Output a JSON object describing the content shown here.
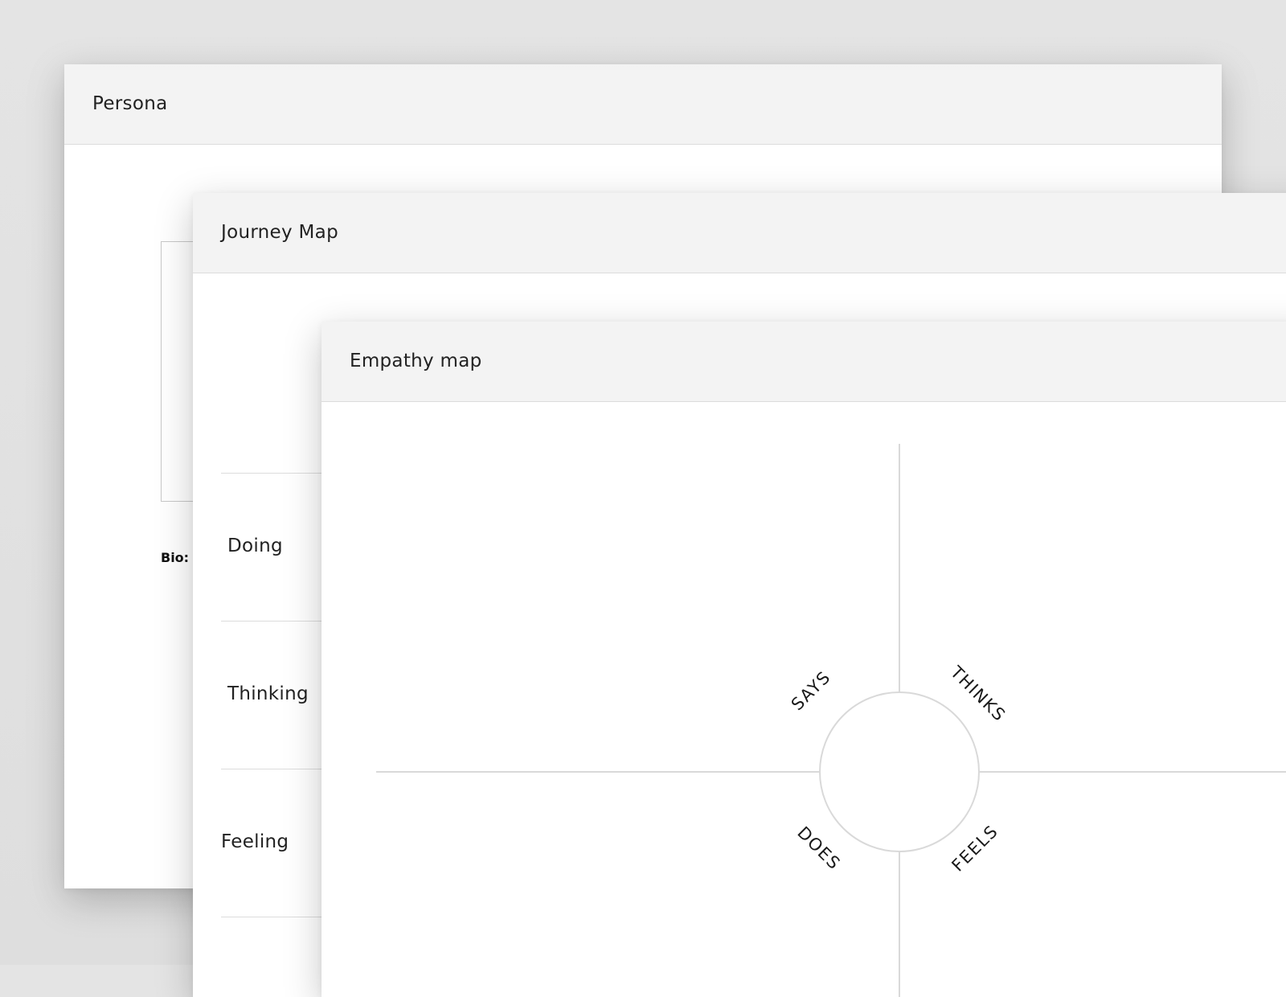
{
  "persona": {
    "title": "Persona",
    "bio_label": "Bio:"
  },
  "journey_map": {
    "title": "Journey Map",
    "rows": [
      "Doing",
      "Thinking",
      "Feeling"
    ]
  },
  "empathy_map": {
    "title": "Empathy map",
    "quadrants": {
      "top_left": "SAYS",
      "top_right": "THINKS",
      "bottom_left": "DOES",
      "bottom_right": "FEELS"
    }
  },
  "colors": {
    "header_bg": "#f3f3f3",
    "divider": "#dcdcdc",
    "background": "#e0e0e0"
  }
}
